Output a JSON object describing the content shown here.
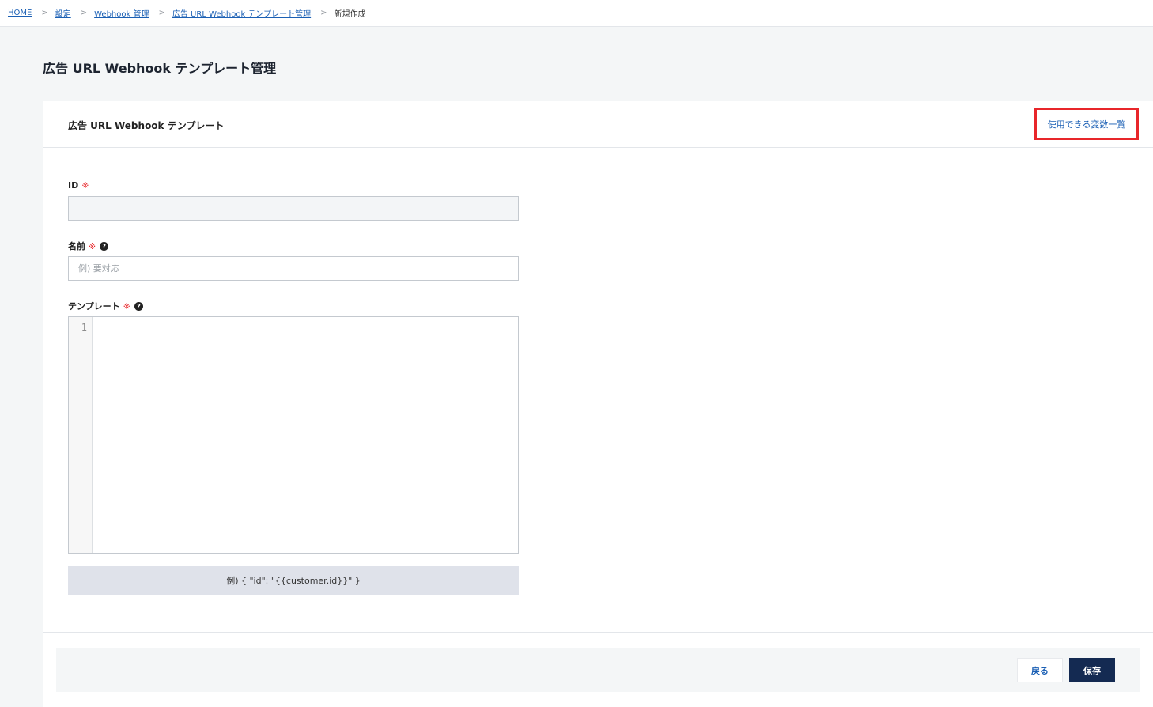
{
  "breadcrumb": {
    "items": [
      "HOME",
      "設定",
      "Webhook 管理",
      "広告 URL Webhook テンプレート管理"
    ],
    "separator": ">",
    "current": "新規作成"
  },
  "page": {
    "title": "広告 URL Webhook テンプレート管理"
  },
  "card": {
    "title": "広告 URL Webhook テンプレート",
    "variables_link": "使用できる変数一覧"
  },
  "form": {
    "required_mark": "※",
    "help_glyph": "?",
    "id": {
      "label": "ID",
      "value": ""
    },
    "name": {
      "label": "名前",
      "placeholder": "例) 要対応"
    },
    "template": {
      "label": "テンプレート",
      "line_number": "1",
      "example": "例) { \"id\": \"{{customer.id}}\" }"
    }
  },
  "buttons": {
    "back": "戻る",
    "save": "保存"
  },
  "colors": {
    "link": "#1a5fb4",
    "required": "#e8262a",
    "primary": "#142a52",
    "highlight_border": "#e8262a"
  }
}
